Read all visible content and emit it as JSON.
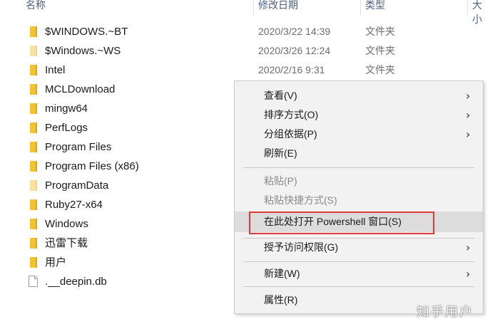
{
  "columns": {
    "name": "名称",
    "modified": "修改日期",
    "type": "类型",
    "size": "大小"
  },
  "files": [
    {
      "name": "$WINDOWS.~BT",
      "date": "2020/3/22 14:39",
      "type": "文件夹",
      "icon": "folder-icon"
    },
    {
      "name": "$Windows.~WS",
      "date": "2020/3/26 12:24",
      "type": "文件夹",
      "icon": "folder-icon"
    },
    {
      "name": "Intel",
      "date": "2020/2/16 9:31",
      "type": "文件夹",
      "icon": "folder-icon"
    },
    {
      "name": "MCLDownload",
      "date": "",
      "type": "",
      "icon": "folder-icon"
    },
    {
      "name": "mingw64",
      "date": "",
      "type": "",
      "icon": "folder-icon"
    },
    {
      "name": "PerfLogs",
      "date": "",
      "type": "",
      "icon": "folder-icon"
    },
    {
      "name": "Program Files",
      "date": "",
      "type": "",
      "icon": "folder-icon"
    },
    {
      "name": "Program Files (x86)",
      "date": "",
      "type": "",
      "icon": "folder-icon"
    },
    {
      "name": "ProgramData",
      "date": "",
      "type": "",
      "icon": "folder-icon"
    },
    {
      "name": "Ruby27-x64",
      "date": "",
      "type": "",
      "icon": "folder-icon"
    },
    {
      "name": "Windows",
      "date": "",
      "type": "",
      "icon": "folder-icon"
    },
    {
      "name": "迅雷下载",
      "date": "",
      "type": "",
      "icon": "folder-icon"
    },
    {
      "name": "用户",
      "date": "",
      "type": "",
      "icon": "folder-icon"
    },
    {
      "name": ".__deepin.db",
      "date": "",
      "type": "",
      "icon": "file-icon"
    }
  ],
  "context_menu": {
    "items": [
      {
        "label": "查看(V)",
        "submenu": true,
        "enabled": true
      },
      {
        "label": "排序方式(O)",
        "submenu": true,
        "enabled": true
      },
      {
        "label": "分组依据(P)",
        "submenu": true,
        "enabled": true
      },
      {
        "label": "刷新(E)",
        "submenu": false,
        "enabled": true
      },
      {
        "label": "粘贴(P)",
        "submenu": false,
        "enabled": false
      },
      {
        "label": "粘贴快捷方式(S)",
        "submenu": false,
        "enabled": false
      },
      {
        "label": "在此处打开 Powershell 窗口(S)",
        "submenu": false,
        "enabled": true,
        "highlighted": true
      },
      {
        "label": "授予访问权限(G)",
        "submenu": true,
        "enabled": true
      },
      {
        "label": "新建(W)",
        "submenu": true,
        "enabled": true
      },
      {
        "label": "属性(R)",
        "submenu": false,
        "enabled": true
      }
    ],
    "submenu_arrow": "›"
  },
  "colors": {
    "highlight_border": "#e03a3a",
    "folder": "#f1c232",
    "menu_bg": "#f2f2f2"
  },
  "watermark": "知乎用户"
}
